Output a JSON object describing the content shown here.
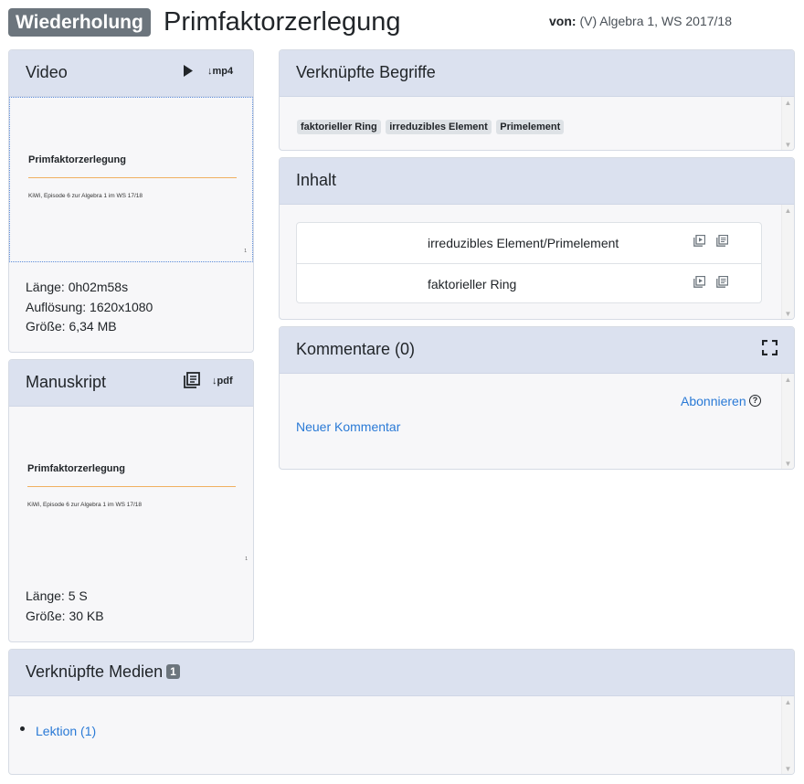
{
  "header": {
    "type_badge": "Wiederholung",
    "title": "Primfaktorzerlegung",
    "author_label": "von:",
    "author_value": "(V) Algebra 1, WS 2017/18"
  },
  "video": {
    "title": "Video",
    "download_label": "↓mp4",
    "thumb_title": "Primfaktorzerlegung",
    "thumb_subtitle": "KiWi, Episode 6 zur Algebra 1 im WS 17/18",
    "thumb_page": "1",
    "length": "Länge: 0h02m58s",
    "resolution": "Auflösung: 1620x1080",
    "size": "Größe: 6,34 MB"
  },
  "manuskript": {
    "title": "Manuskript",
    "download_label": "↓pdf",
    "thumb_title": "Primfaktorzerlegung",
    "thumb_subtitle": "KiWi, Episode 6 zur Algebra 1 im WS 17/18",
    "thumb_page": "1",
    "length": "Länge: 5 S",
    "size": "Größe: 30 KB"
  },
  "begriffe": {
    "title": "Verknüpfte Begriffe",
    "tags": [
      "faktorieller Ring",
      "irreduzibles Element",
      "Primelement"
    ]
  },
  "inhalt": {
    "title": "Inhalt",
    "items": [
      {
        "label": "irreduzibles Element/Primelement"
      },
      {
        "label": "faktorieller Ring"
      }
    ]
  },
  "kommentare": {
    "title": "Kommentare (0)",
    "subscribe": "Abonnieren",
    "new_comment": "Neuer Kommentar"
  },
  "medien": {
    "title": "Verknüpfte Medien",
    "count": "1",
    "items": [
      {
        "label": "Lektion (1)"
      }
    ]
  }
}
